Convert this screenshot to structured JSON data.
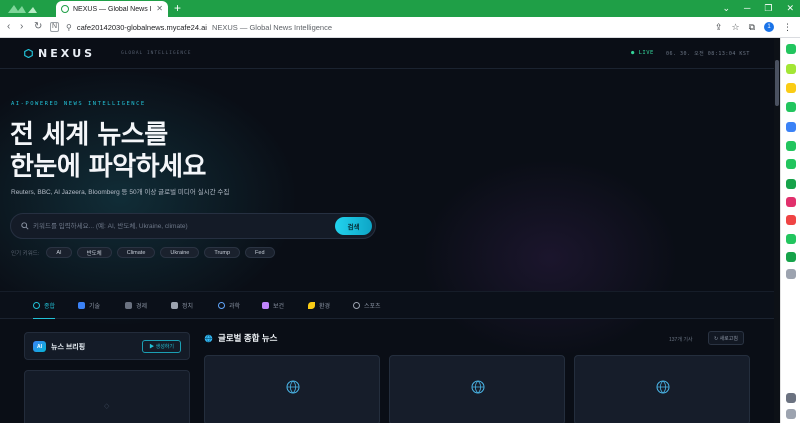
{
  "browser": {
    "tab_title": "NEXUS — Global News Intellige",
    "url_host": "cafe20142030-globalnews.mycafe24.ai",
    "url_page_title": "NEXUS — Global News Intelligence",
    "accent_color": "#1f9f47"
  },
  "header": {
    "logo": "NEXUS",
    "logo_subtitle": "GLOBAL INTELLIGENCE",
    "live_label": "● LIVE",
    "clock": "06. 30. 오전 08:13:04 KST"
  },
  "hero": {
    "eyebrow": "AI-POWERED NEWS INTELLIGENCE",
    "headline_line1": "전 세계 뉴스를",
    "headline_line2": "한눈에 파악하세요",
    "description": "Reuters, BBC, Al Jazeera, Bloomberg 등 50개 이상 글로벌 미디어 실시간 수집"
  },
  "search": {
    "placeholder": "키워드를 입력하세요... (예: AI, 반도체, Ukraine, climate)",
    "value": "",
    "button_label": "검색"
  },
  "keywords": {
    "label": "인기 키워드:",
    "items": [
      "AI",
      "반도체",
      "Climate",
      "Ukraine",
      "Trump",
      "Fed"
    ]
  },
  "categories": [
    {
      "label": "종합",
      "active": true,
      "icon": "globe-icon",
      "color": "#22c1d6"
    },
    {
      "label": "기술",
      "active": false,
      "icon": "laptop-icon",
      "color": "#3b82f6"
    },
    {
      "label": "경제",
      "active": false,
      "icon": "chart-icon",
      "color": "#8a93a2"
    },
    {
      "label": "정치",
      "active": false,
      "icon": "building-icon",
      "color": "#9ca3af"
    },
    {
      "label": "과학",
      "active": false,
      "icon": "atom-icon",
      "color": "#60a5fa"
    },
    {
      "label": "보건",
      "active": false,
      "icon": "medicine-icon",
      "color": "#c084fc"
    },
    {
      "label": "환경",
      "active": false,
      "icon": "leaf-icon",
      "color": "#facc15"
    },
    {
      "label": "스포츠",
      "active": false,
      "icon": "ball-icon",
      "color": "#9ca3af"
    }
  ],
  "briefing": {
    "badge": "AI",
    "title": "뉴스 브리핑",
    "generate_button": "▶ 생성하기",
    "placeholder_icon": "◇"
  },
  "feed": {
    "icon": "globe-icon",
    "title": "글로벌 종합 뉴스",
    "count": "137개 기사",
    "refresh_button": "↻ 새로고침",
    "cards": 3
  }
}
